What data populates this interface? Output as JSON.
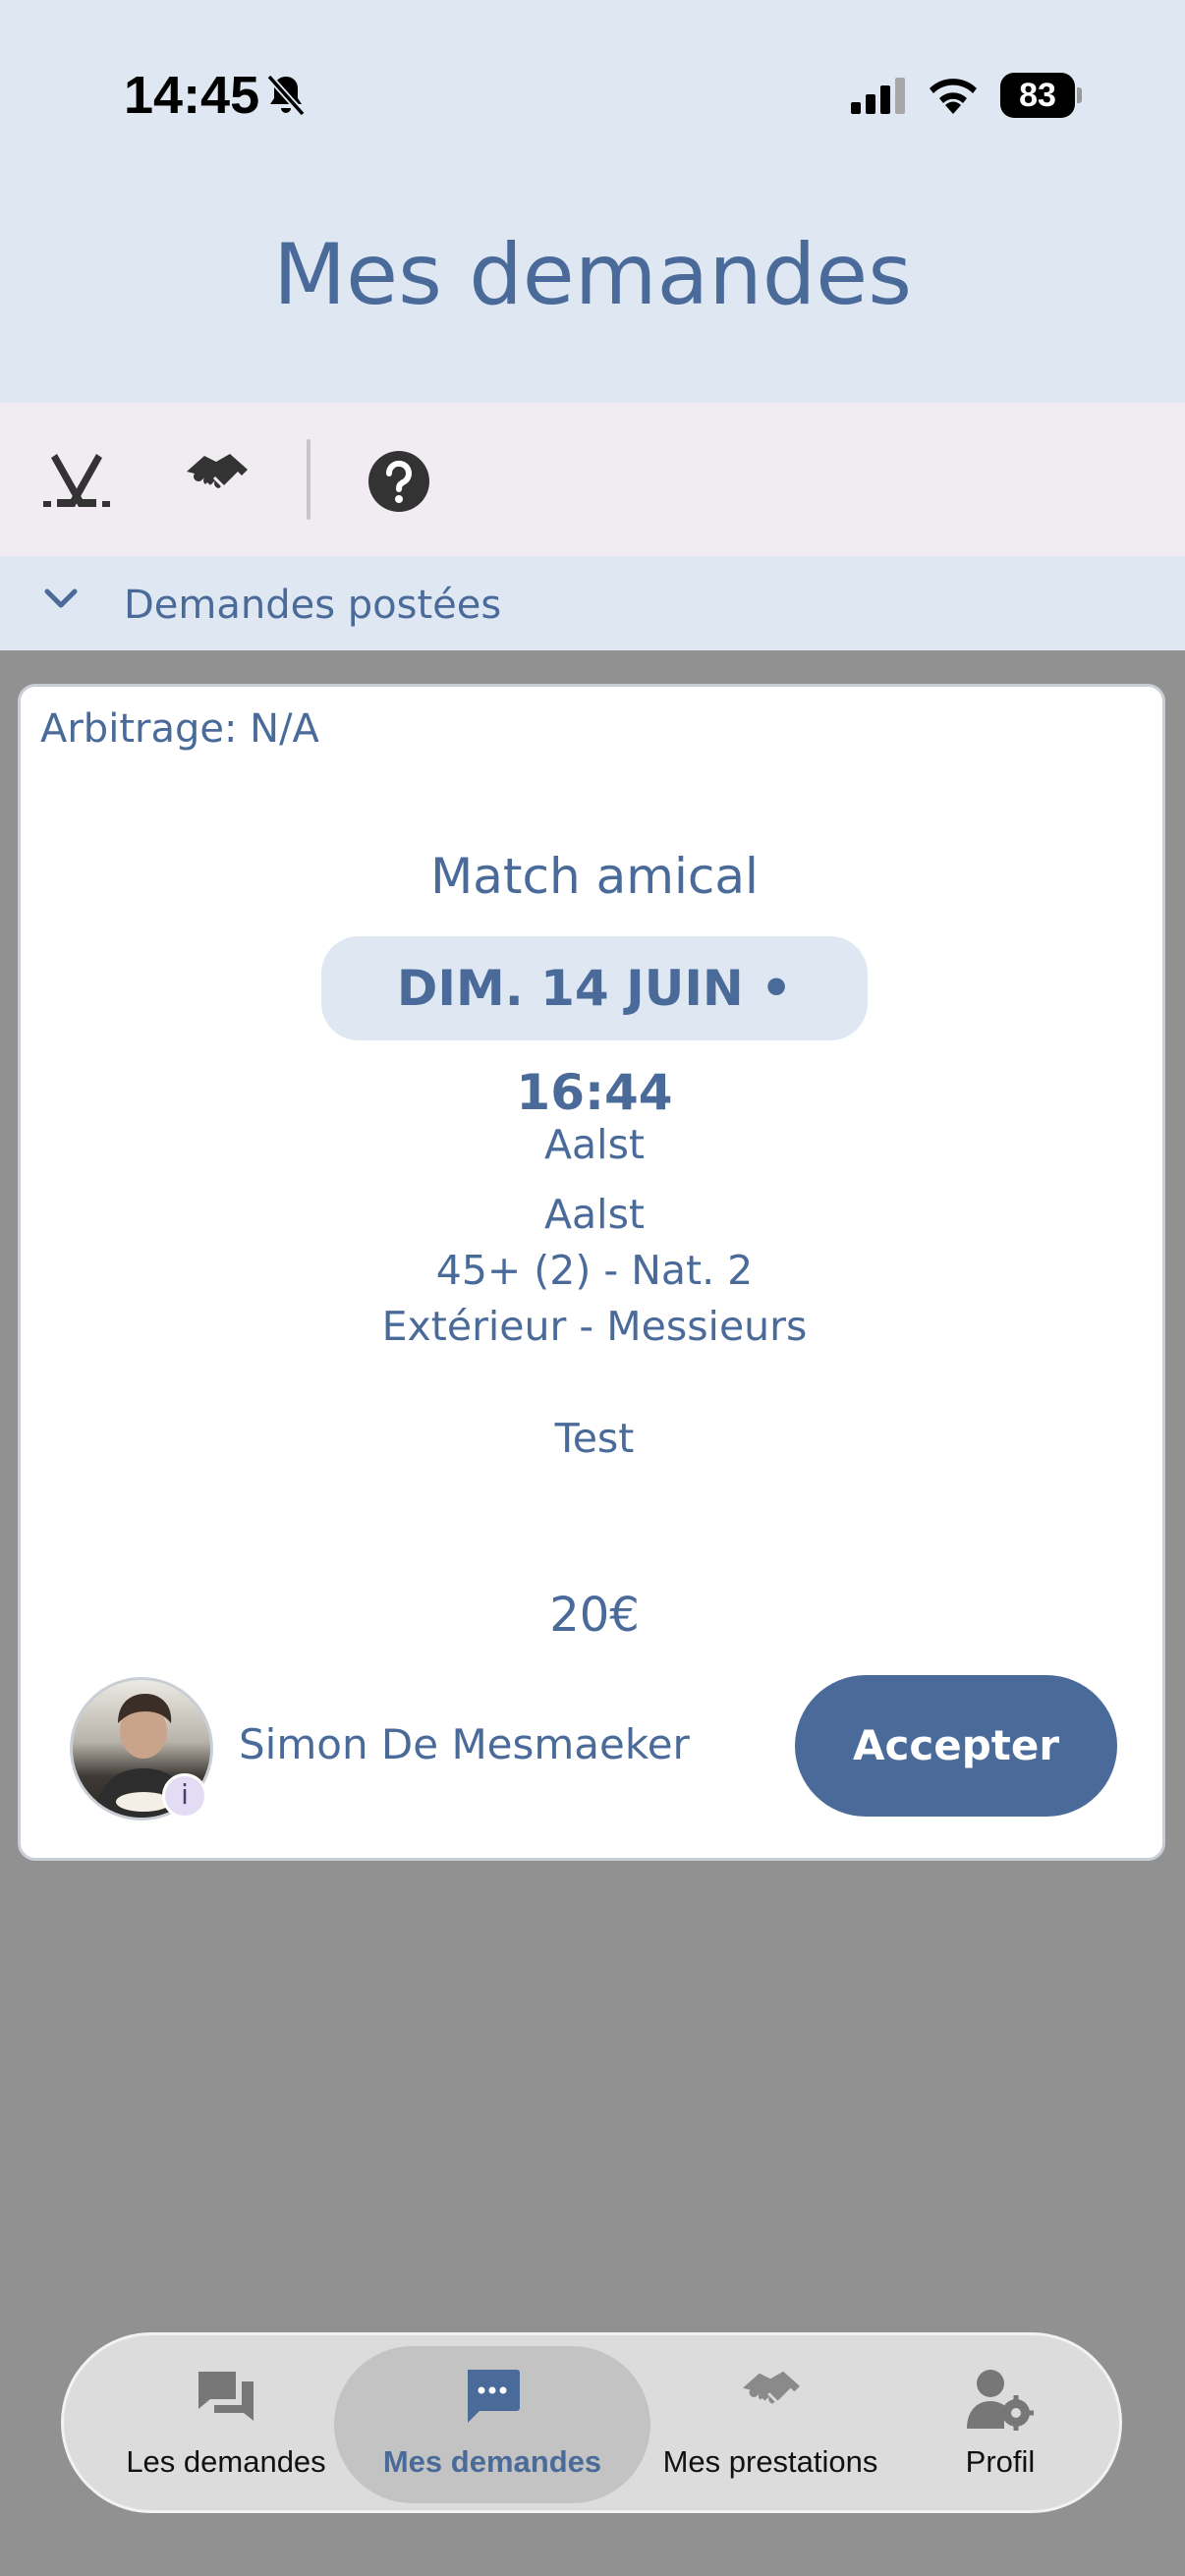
{
  "status_bar": {
    "time": "14:45",
    "battery": "83",
    "icons": [
      "bell-off-icon",
      "cellular-signal-icon",
      "wifi-icon",
      "battery-icon"
    ]
  },
  "header": {
    "title": "Mes demandes"
  },
  "toolbar": {
    "icons": [
      "hockey-sticks-icon",
      "handshake-icon",
      "help-icon"
    ]
  },
  "section": {
    "label": "Demandes postées",
    "icon": "chevron-down-icon"
  },
  "card": {
    "arbitrage": "Arbitrage: N/A",
    "match_type": "Match amical",
    "datetime": "DIM. 14 JUIN • 16:44",
    "location": "Aalst",
    "team": "Aalst",
    "category": "45+ (2) - Nat. 2",
    "venue_gender": "Extérieur - Messieurs",
    "note": "Test",
    "price": "20€",
    "user_name": "Simon De Mesmaeker",
    "avatar_info": "i",
    "accept_label": "Accepter"
  },
  "bottom_nav": {
    "items": [
      {
        "label": "Les demandes",
        "icon": "chat-bubbles-icon",
        "active": false
      },
      {
        "label": "Mes demandes",
        "icon": "chat-dots-icon",
        "active": true
      },
      {
        "label": "Mes prestations",
        "icon": "handshake-icon",
        "active": false
      },
      {
        "label": "Profil",
        "icon": "user-settings-icon",
        "active": false
      }
    ]
  },
  "colors": {
    "accent": "#4a6b9a",
    "header_bg": "#dfe7f2",
    "toolbar_bg": "#f0ecf1",
    "overlay": "#919191"
  }
}
